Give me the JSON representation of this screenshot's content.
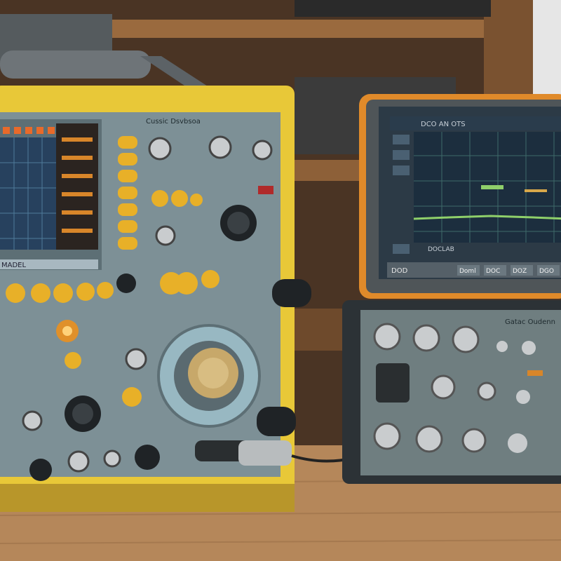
{
  "scene": {
    "description_free": true,
    "colors": {
      "wall": "#4a3424",
      "shelf": "#9a6a3e",
      "bench_top": "#b5875a",
      "bench_dark": "#8a5f3a",
      "yellow_frame": "#e8c838",
      "yellow_frame_dark": "#b8962a",
      "panel_gray": "#7d9096",
      "panel_gray_dark": "#5d6f75",
      "knob_yellow": "#e8b028",
      "knob_black": "#1f2326",
      "knob_silver": "#c9ccce",
      "screen_blue": "#27415e",
      "grid_line": "#4f7a9a",
      "orange_frame": "#e08a2a",
      "scope_screen": "#1c2e3e",
      "trace_green": "#8fd06a",
      "device_dark": "#2c3236",
      "device_panel": "#6f7e80"
    }
  },
  "labels": {
    "left_panel_header": "Cussic Dsvbsoa",
    "left_readout": "MADEL",
    "right_device_header": "Gatac Oudenn",
    "scope_menu_top": "DCO AN OTS",
    "scope_footer_left": "DOD",
    "scope_footer_tabs": [
      "Doml",
      "DOC",
      "DOZ",
      "DGO"
    ],
    "scope_bottom_readout": "DOCLAB"
  }
}
